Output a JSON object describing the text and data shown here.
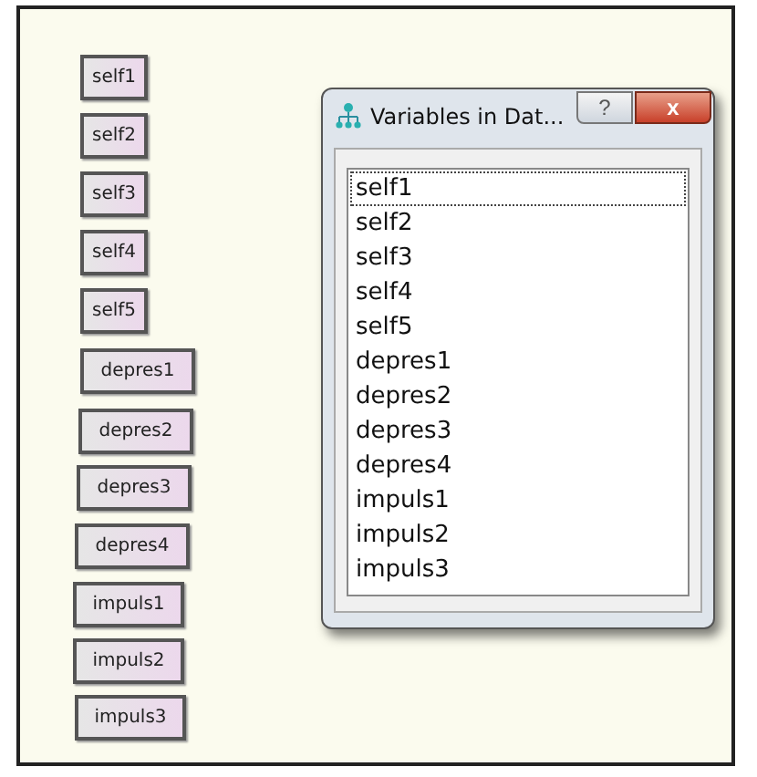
{
  "canvas": {
    "nodes": [
      {
        "label": "self1"
      },
      {
        "label": "self2"
      },
      {
        "label": "self3"
      },
      {
        "label": "self4"
      },
      {
        "label": "self5"
      },
      {
        "label": "depres1"
      },
      {
        "label": "depres2"
      },
      {
        "label": "depres3"
      },
      {
        "label": "depres4"
      },
      {
        "label": "impuls1"
      },
      {
        "label": "impuls2"
      },
      {
        "label": "impuls3"
      }
    ]
  },
  "dialog": {
    "title": "Variables in Dat...",
    "help_button": "?",
    "close_button": "x",
    "items": [
      {
        "label": "self1",
        "selected": true
      },
      {
        "label": "self2",
        "selected": false
      },
      {
        "label": "self3",
        "selected": false
      },
      {
        "label": "self4",
        "selected": false
      },
      {
        "label": "self5",
        "selected": false
      },
      {
        "label": "depres1",
        "selected": false
      },
      {
        "label": "depres2",
        "selected": false
      },
      {
        "label": "depres3",
        "selected": false
      },
      {
        "label": "depres4",
        "selected": false
      },
      {
        "label": "impuls1",
        "selected": false
      },
      {
        "label": "impuls2",
        "selected": false
      },
      {
        "label": "impuls3",
        "selected": false
      }
    ]
  }
}
